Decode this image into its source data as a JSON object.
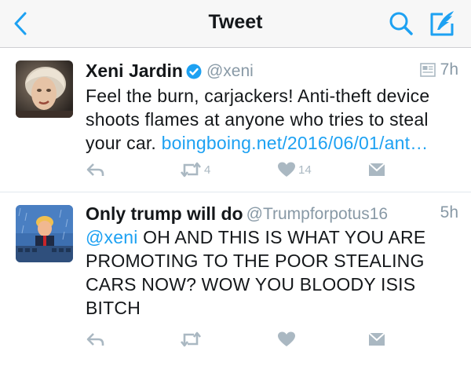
{
  "navbar": {
    "title": "Tweet",
    "back_icon": "chevron-left-icon",
    "search_icon": "search-icon",
    "compose_icon": "compose-tweet-icon",
    "accent": "#1da1f2"
  },
  "tweets": [
    {
      "name": "Xeni Jardin",
      "verified": true,
      "handle": "@xeni",
      "time": "7h",
      "has_card_icon": true,
      "text": "Feel the burn, carjackers! Anti-theft device shoots flames at anyone who tries to steal your car. ",
      "link": "boingboing.net/2016/06/01/ant…",
      "actions": {
        "reply": "",
        "retweet": "4",
        "like": "14",
        "message": ""
      }
    },
    {
      "name": "Only trump will do",
      "verified": false,
      "handle": "@Trumpforpotus16",
      "time": "5h",
      "mention": "@xeni",
      "text": " OH AND THIS IS WHAT YOU ARE PROMOTING TO THE POOR STEALING CARS  NOW? WOW YOU BLOODY ISIS BITCH",
      "actions": {
        "reply": "",
        "retweet": "",
        "like": "",
        "message": ""
      }
    }
  ],
  "colors": {
    "link": "#1da1f2",
    "muted": "#8899a6",
    "icon": "#aab8c2"
  }
}
